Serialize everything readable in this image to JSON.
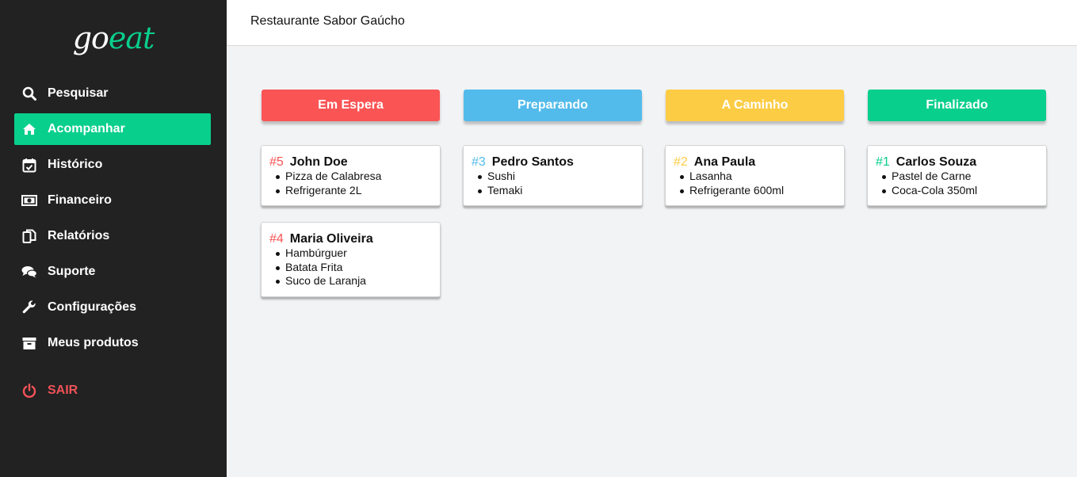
{
  "app": {
    "logo_part1": "go",
    "logo_part2": "eat",
    "restaurant_name": "Restaurante Sabor Gaúcho"
  },
  "colors": {
    "accent": "#09cf8c",
    "em_espera": "#fa5455",
    "preparando": "#53bbeb",
    "a_caminho": "#fccc45",
    "finalizado": "#09cf8c",
    "logout": "#f15258"
  },
  "sidebar": {
    "items": [
      {
        "label": "Pesquisar",
        "icon": "search-icon"
      },
      {
        "label": "Acompanhar",
        "icon": "home-icon"
      },
      {
        "label": "Histórico",
        "icon": "calendar-check-icon"
      },
      {
        "label": "Financeiro",
        "icon": "money-bill-icon"
      },
      {
        "label": "Relatórios",
        "icon": "documents-icon"
      },
      {
        "label": "Suporte",
        "icon": "comments-icon"
      },
      {
        "label": "Configurações",
        "icon": "wrench-icon"
      },
      {
        "label": "Meus produtos",
        "icon": "archive-box-icon"
      }
    ],
    "logout": {
      "label": "SAIR",
      "icon": "power-icon"
    }
  },
  "board": {
    "columns": [
      {
        "title": "Em Espera",
        "orders": [
          {
            "num": "#5",
            "name": "John Doe",
            "items": [
              "Pizza de Calabresa",
              "Refrigerante 2L"
            ]
          },
          {
            "num": "#4",
            "name": "Maria Oliveira",
            "items": [
              "Hambúrguer",
              "Batata Frita",
              "Suco de Laranja"
            ]
          }
        ]
      },
      {
        "title": "Preparando",
        "orders": [
          {
            "num": "#3",
            "name": "Pedro Santos",
            "items": [
              "Sushi",
              "Temaki"
            ]
          }
        ]
      },
      {
        "title": "A Caminho",
        "orders": [
          {
            "num": "#2",
            "name": "Ana Paula",
            "items": [
              "Lasanha",
              "Refrigerante 600ml"
            ]
          }
        ]
      },
      {
        "title": "Finalizado",
        "orders": [
          {
            "num": "#1",
            "name": "Carlos Souza",
            "items": [
              "Pastel de Carne",
              "Coca-Cola 350ml"
            ]
          }
        ]
      }
    ]
  }
}
